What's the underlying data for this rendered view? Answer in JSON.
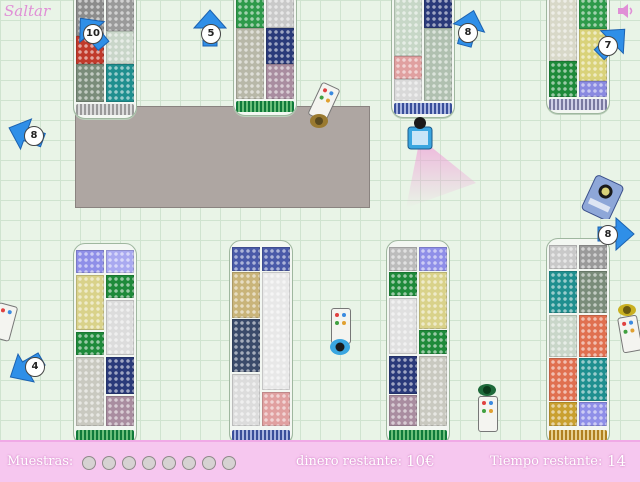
{
  "top": {
    "skip_label": "Saltar",
    "sound_icon": "speaker-icon"
  },
  "arrows": [
    {
      "number": "10",
      "direction": "up-left"
    },
    {
      "number": "5",
      "direction": "up"
    },
    {
      "number": "8",
      "direction": "up"
    },
    {
      "number": "7",
      "direction": "up-right"
    },
    {
      "number": "8",
      "direction": "left"
    },
    {
      "number": "8",
      "direction": "right"
    },
    {
      "number": "4",
      "direction": "down-left"
    }
  ],
  "hud": {
    "samples_label": "Muestras:",
    "samples_total": 8,
    "samples_collected": 0,
    "money_label": "dinero restante:",
    "money_value": "10€",
    "time_label": "Tiempo restante:",
    "time_value": "14"
  },
  "colors": {
    "hud_bg": "#f6c7ef",
    "arrow_blue": "#2f8fe8",
    "floor": "#e9f4e7",
    "blocked_area": "#aea6a2"
  }
}
